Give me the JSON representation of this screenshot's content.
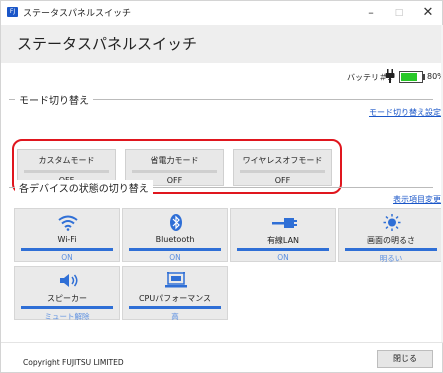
{
  "window": {
    "app_icon_text": "FJ",
    "title": "ステータスパネルスイッチ",
    "minimize": "–",
    "maximize": "□",
    "close": "✕"
  },
  "header": {
    "title": "ステータスパネルスイッチ"
  },
  "battery": {
    "label": "バッテリ＃1",
    "percent_text": "80%",
    "level": 0.8,
    "fill_color": "#28c828"
  },
  "mode_section": {
    "title": "モード切り替え",
    "link": "モード切り替え設定",
    "buttons": [
      {
        "label": "カスタムモード",
        "value": "OFF"
      },
      {
        "label": "省電力モード",
        "value": "OFF"
      },
      {
        "label": "ワイヤレスオフモード",
        "value": "OFF"
      }
    ],
    "highlight_color": "#e0161e"
  },
  "device_section": {
    "title": "各デバイスの状態の切り替え",
    "link": "表示項目変更",
    "devices": [
      {
        "icon": "wifi-icon",
        "label": "Wi-Fi",
        "state": "ON"
      },
      {
        "icon": "bluetooth-icon",
        "label": "Bluetooth",
        "state": "ON"
      },
      {
        "icon": "wired-lan-icon",
        "label": "有線LAN",
        "state": "ON"
      },
      {
        "icon": "brightness-icon",
        "label": "画面の明るさ",
        "state": "明るい"
      },
      {
        "icon": "speaker-icon",
        "label": "スピーカー",
        "state": "ミュート解除"
      },
      {
        "icon": "cpu-performance-icon",
        "label": "CPUパフォーマンス",
        "state": "高"
      }
    ],
    "accent_color": "#2f6fd6"
  },
  "footer": {
    "copyright": "Copyright FUJITSU LIMITED",
    "close_button": "閉じる"
  }
}
